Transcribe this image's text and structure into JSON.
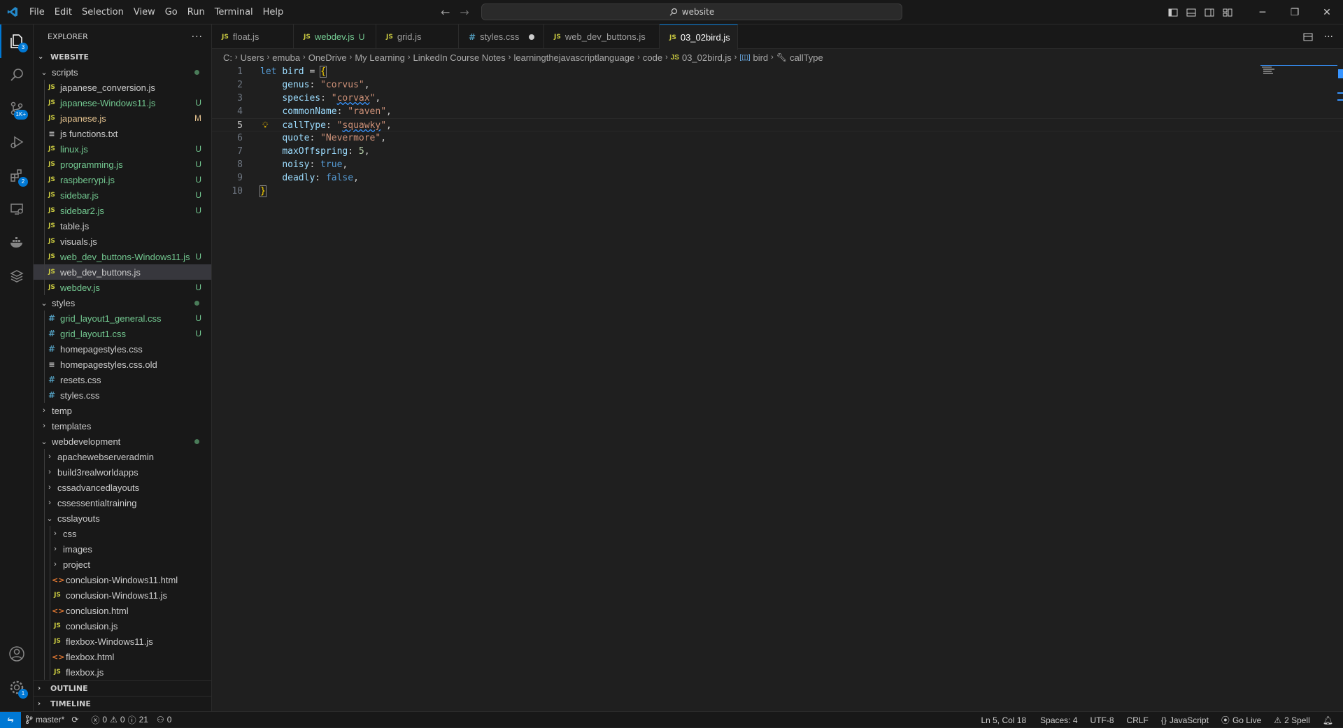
{
  "menu": [
    "File",
    "Edit",
    "Selection",
    "View",
    "Go",
    "Run",
    "Terminal",
    "Help"
  ],
  "search": {
    "text": "website"
  },
  "activity": {
    "scm_badge": "3",
    "source_badge": "1K+",
    "ext_badge": "2",
    "settings_badge": "1"
  },
  "explorer": {
    "title": "EXPLORER",
    "root": "WEBSITE",
    "rows": [
      {
        "type": "folder",
        "label": "scripts",
        "depth": 0,
        "open": true,
        "dot": true
      },
      {
        "type": "js",
        "label": "japanese_conversion.js",
        "depth": 1,
        "status": "",
        "color": "#cccccc"
      },
      {
        "type": "js",
        "label": "japanese-Windows11.js",
        "depth": 1,
        "status": "U",
        "color": "#73c991"
      },
      {
        "type": "js",
        "label": "japanese.js",
        "depth": 1,
        "status": "M",
        "color": "#e2c08d"
      },
      {
        "type": "txt",
        "label": "js functions.txt",
        "depth": 1,
        "status": "",
        "color": "#cccccc"
      },
      {
        "type": "js",
        "label": "linux.js",
        "depth": 1,
        "status": "U",
        "color": "#73c991"
      },
      {
        "type": "js",
        "label": "programming.js",
        "depth": 1,
        "status": "U",
        "color": "#73c991"
      },
      {
        "type": "js",
        "label": "raspberrypi.js",
        "depth": 1,
        "status": "U",
        "color": "#73c991"
      },
      {
        "type": "js",
        "label": "sidebar.js",
        "depth": 1,
        "status": "U",
        "color": "#73c991"
      },
      {
        "type": "js",
        "label": "sidebar2.js",
        "depth": 1,
        "status": "U",
        "color": "#73c991"
      },
      {
        "type": "js",
        "label": "table.js",
        "depth": 1,
        "status": "",
        "color": "#cccccc"
      },
      {
        "type": "js",
        "label": "visuals.js",
        "depth": 1,
        "status": "",
        "color": "#cccccc"
      },
      {
        "type": "js",
        "label": "web_dev_buttons-Windows11.js",
        "depth": 1,
        "status": "U",
        "color": "#73c991"
      },
      {
        "type": "js",
        "label": "web_dev_buttons.js",
        "depth": 1,
        "status": "",
        "color": "#cccccc",
        "selected": true
      },
      {
        "type": "js",
        "label": "webdev.js",
        "depth": 1,
        "status": "U",
        "color": "#73c991"
      },
      {
        "type": "folder",
        "label": "styles",
        "depth": 0,
        "open": true,
        "dot": true
      },
      {
        "type": "css",
        "label": "grid_layout1_general.css",
        "depth": 1,
        "status": "U",
        "color": "#73c991"
      },
      {
        "type": "css",
        "label": "grid_layout1.css",
        "depth": 1,
        "status": "U",
        "color": "#73c991"
      },
      {
        "type": "css",
        "label": "homepagestyles.css",
        "depth": 1,
        "status": "",
        "color": "#cccccc"
      },
      {
        "type": "txt",
        "label": "homepagestyles.css.old",
        "depth": 1,
        "status": "",
        "color": "#cccccc"
      },
      {
        "type": "css",
        "label": "resets.css",
        "depth": 1,
        "status": "",
        "color": "#cccccc"
      },
      {
        "type": "css",
        "label": "styles.css",
        "depth": 1,
        "status": "",
        "color": "#cccccc"
      },
      {
        "type": "folder",
        "label": "temp",
        "depth": 0,
        "open": false
      },
      {
        "type": "folder",
        "label": "templates",
        "depth": 0,
        "open": false
      },
      {
        "type": "folder",
        "label": "webdevelopment",
        "depth": 0,
        "open": true,
        "dot": true
      },
      {
        "type": "folder",
        "label": "apachewebserveradmin",
        "depth": 1,
        "open": false
      },
      {
        "type": "folder",
        "label": "build3realworldapps",
        "depth": 1,
        "open": false
      },
      {
        "type": "folder",
        "label": "cssadvancedlayouts",
        "depth": 1,
        "open": false
      },
      {
        "type": "folder",
        "label": "cssessentialtraining",
        "depth": 1,
        "open": false
      },
      {
        "type": "folder",
        "label": "csslayouts",
        "depth": 1,
        "open": true
      },
      {
        "type": "folder",
        "label": "css",
        "depth": 2,
        "open": false
      },
      {
        "type": "folder",
        "label": "images",
        "depth": 2,
        "open": false
      },
      {
        "type": "folder",
        "label": "project",
        "depth": 2,
        "open": false
      },
      {
        "type": "html",
        "label": "conclusion-Windows11.html",
        "depth": 2,
        "status": "",
        "color": "#cccccc"
      },
      {
        "type": "js",
        "label": "conclusion-Windows11.js",
        "depth": 2,
        "status": "",
        "color": "#cccccc"
      },
      {
        "type": "html",
        "label": "conclusion.html",
        "depth": 2,
        "status": "",
        "color": "#cccccc"
      },
      {
        "type": "js",
        "label": "conclusion.js",
        "depth": 2,
        "status": "",
        "color": "#cccccc"
      },
      {
        "type": "js",
        "label": "flexbox-Windows11.js",
        "depth": 2,
        "status": "",
        "color": "#cccccc"
      },
      {
        "type": "html",
        "label": "flexbox.html",
        "depth": 2,
        "status": "",
        "color": "#cccccc"
      },
      {
        "type": "js",
        "label": "flexbox.js",
        "depth": 2,
        "status": "",
        "color": "#cccccc"
      }
    ],
    "outline": "OUTLINE",
    "timeline": "TIMELINE"
  },
  "tabs": [
    {
      "icon": "JS",
      "label": "float.js",
      "mark": "",
      "dirty": false,
      "active": false,
      "color": "#9d9d9d"
    },
    {
      "icon": "JS",
      "label": "webdev.js",
      "mark": "U",
      "dirty": false,
      "active": false,
      "color": "#73c991"
    },
    {
      "icon": "JS",
      "label": "grid.js",
      "mark": "",
      "dirty": false,
      "active": false,
      "color": "#9d9d9d"
    },
    {
      "icon": "#",
      "label": "styles.css",
      "mark": "",
      "dirty": true,
      "active": false,
      "color": "#9d9d9d"
    },
    {
      "icon": "JS",
      "label": "web_dev_buttons.js",
      "mark": "",
      "dirty": true,
      "active": false,
      "color": "#9d9d9d"
    },
    {
      "icon": "JS",
      "label": "03_02bird.js",
      "mark": "",
      "dirty": true,
      "active": true,
      "color": "#ffffff"
    }
  ],
  "breadcrumb": [
    "C:",
    "Users",
    "emuba",
    "OneDrive",
    "My Learning",
    "LinkedIn Course Notes",
    "learningthejavascriptlanguage",
    "code",
    "03_02bird.js",
    "bird",
    "callType"
  ],
  "code_lines": [
    "let bird = {",
    "    genus: \"corvus\",",
    "    species: \"corvax\",",
    "    commonName: \"raven\",",
    "    callType: \"squawky\",",
    "    quote: \"Nevermore\",",
    "    maxOffspring: 5,",
    "    noisy: true,",
    "    deadly: false,",
    "}"
  ],
  "status": {
    "branch": "master*",
    "errors": "0",
    "warnings": "0",
    "info": "21",
    "ports": "0",
    "position": "Ln 5, Col 18",
    "spaces": "Spaces: 4",
    "encoding": "UTF-8",
    "eol": "CRLF",
    "language": "JavaScript",
    "golive": "Go Live",
    "spell": "2 Spell"
  },
  "colors": {
    "accent": "#0078d4",
    "untracked": "#73c991",
    "modified": "#e2c08d"
  }
}
